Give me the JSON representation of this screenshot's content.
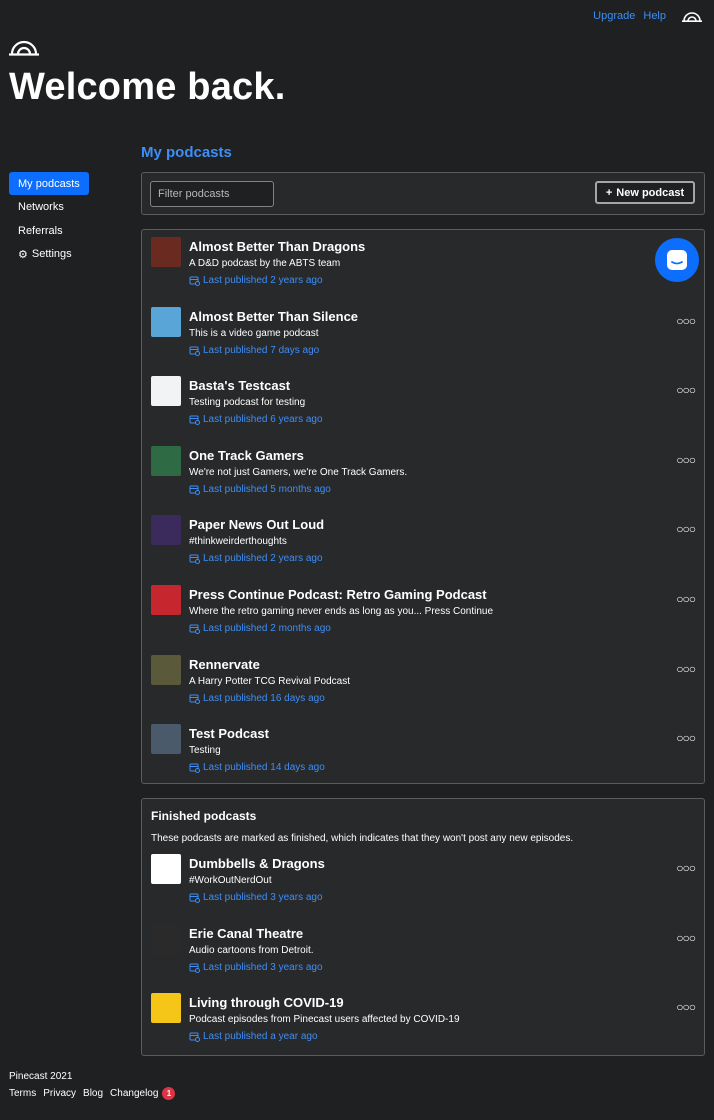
{
  "topbar": {
    "upgrade": "Upgrade",
    "help": "Help",
    "logo_icon": "pinecast-logo-icon"
  },
  "header": {
    "title": "Welcome back."
  },
  "sidebar": {
    "items": [
      {
        "label": "My podcasts",
        "active": true
      },
      {
        "label": "Networks"
      },
      {
        "label": "Referrals"
      },
      {
        "label": "Settings",
        "icon": "gear-icon"
      }
    ]
  },
  "main": {
    "section_title": "My podcasts",
    "filter_placeholder": "Filter podcasts",
    "new_podcast_label": "New podcast",
    "new_podcast_icon": "plus-icon",
    "podcasts": [
      {
        "name": "Almost Better Than Dragons",
        "description": "A D&D podcast by the ABTS team",
        "published": "Last published 2 years ago",
        "art_color": "#6b2a1f"
      },
      {
        "name": "Almost Better Than Silence",
        "description": "This is a video game podcast",
        "published": "Last published 7 days ago",
        "art_color": "#5aa5d8"
      },
      {
        "name": "Basta's Testcast",
        "description": "Testing podcast for testing",
        "published": "Last published 6 years ago",
        "art_color": "#f1f3f5"
      },
      {
        "name": "One Track Gamers",
        "description": "We're not just Gamers, we're One Track Gamers.",
        "published": "Last published 5 months ago",
        "art_color": "#2e6b45"
      },
      {
        "name": "Paper News Out Loud",
        "description": "#thinkweirderthoughts",
        "published": "Last published 2 years ago",
        "art_color": "#3b2a5c"
      },
      {
        "name": "Press Continue Podcast: Retro Gaming Podcast",
        "description": "Where the retro gaming never ends as long as you... Press Continue",
        "published": "Last published 2 months ago",
        "art_color": "#c6262e"
      },
      {
        "name": "Rennervate",
        "description": "A Harry Potter TCG Revival Podcast",
        "published": "Last published 16 days ago",
        "art_color": "#5a5a3a"
      },
      {
        "name": "Test Podcast",
        "description": "Testing",
        "published": "Last published 14 days ago",
        "art_color": "#4a5a6a"
      }
    ],
    "finished": {
      "title": "Finished podcasts",
      "note": "These podcasts are marked as finished, which indicates that they won't post any new episodes.",
      "podcasts": [
        {
          "name": "Dumbbells & Dragons",
          "description": "#WorkOutNerdOut",
          "published": "Last published 3 years ago",
          "art_color": "#ffffff"
        },
        {
          "name": "Erie Canal Theatre",
          "description": "Audio cartoons from Detroit.",
          "published": "Last published 3 years ago",
          "art_color": "#2a2a2a"
        },
        {
          "name": "Living through COVID-19",
          "description": "Podcast episodes from Pinecast users affected by COVID-19",
          "published": "Last published a year ago",
          "art_color": "#f5c518"
        }
      ]
    }
  },
  "chat_icon": "chat-bubble-icon",
  "footer": {
    "copyright": "Pinecast 2021",
    "links": [
      "Terms",
      "Privacy",
      "Blog",
      "Changelog"
    ],
    "changelog_badge": "1"
  },
  "colors": {
    "background": "#1f2021",
    "accent": "#0d6efd",
    "link": "#3d8ef7",
    "panel": "#28292b",
    "badge": "#dc3545"
  }
}
